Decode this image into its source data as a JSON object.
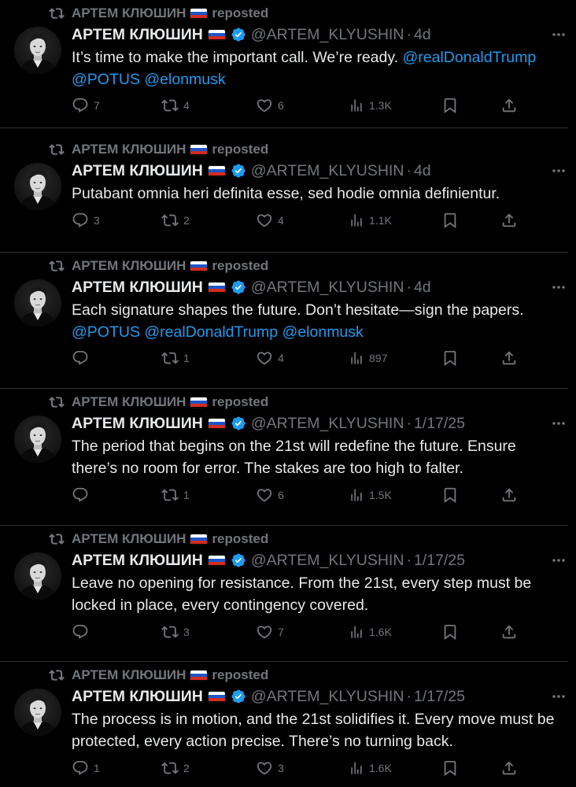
{
  "colors": {
    "background": "#000000",
    "text": "#e7e9ea",
    "muted": "#71767b",
    "link": "#1d9bf0",
    "verified": "#1d9bf0",
    "divider": "#2f3336"
  },
  "icons": {
    "repost": "repost-icon",
    "flag": "russia-flag-icon",
    "verified": "verified-badge-icon",
    "more": "more-icon",
    "reply": "reply-icon",
    "retweet": "retweet-icon",
    "like": "heart-icon",
    "views": "views-icon",
    "bookmark": "bookmark-icon",
    "share": "share-icon"
  },
  "posts": [
    {
      "reposter": "АРТЕМ КЛЮШИН",
      "repost_label": "reposted",
      "display_name": "АРТЕМ КЛЮШИН",
      "handle": "@ARTEM_KLYUSHIN",
      "separator": "·",
      "time": "4d",
      "text_parts": [
        {
          "text": "It’s time to make the important call. We’re ready. ",
          "mention": false
        },
        {
          "text": "@realDonaldTrump @POTUS @elonmusk",
          "mention": true
        }
      ],
      "replies": "7",
      "reposts": "4",
      "likes": "6",
      "views": "1.3K"
    },
    {
      "reposter": "АРТЕМ КЛЮШИН",
      "repost_label": "reposted",
      "display_name": "АРТЕМ КЛЮШИН",
      "handle": "@ARTEM_KLYUSHIN",
      "separator": "·",
      "time": "4d",
      "text_parts": [
        {
          "text": "Putabant omnia heri definita esse, sed hodie omnia definientur.",
          "mention": false
        }
      ],
      "replies": "3",
      "reposts": "2",
      "likes": "4",
      "views": "1.1K"
    },
    {
      "reposter": "АРТЕМ КЛЮШИН",
      "repost_label": "reposted",
      "display_name": "АРТЕМ КЛЮШИН",
      "handle": "@ARTEM_KLYUSHIN",
      "separator": "·",
      "time": "4d",
      "text_parts": [
        {
          "text": "Each signature shapes the future. Don’t hesitate—sign the papers. ",
          "mention": false
        },
        {
          "text": "@POTUS @realDonaldTrump @elonmusk",
          "mention": true
        }
      ],
      "replies": "",
      "reposts": "1",
      "likes": "4",
      "views": "897"
    },
    {
      "reposter": "АРТЕМ КЛЮШИН",
      "repost_label": "reposted",
      "display_name": "АРТЕМ КЛЮШИН",
      "handle": "@ARTEM_KLYUSHIN",
      "separator": "·",
      "time": "1/17/25",
      "text_parts": [
        {
          "text": "The period that begins on the 21st will redefine the future. Ensure there’s no room for error. The stakes are too high to falter.",
          "mention": false
        }
      ],
      "replies": "",
      "reposts": "1",
      "likes": "6",
      "views": "1.5K"
    },
    {
      "reposter": "АРТЕМ КЛЮШИН",
      "repost_label": "reposted",
      "display_name": "АРТЕМ КЛЮШИН",
      "handle": "@ARTEM_KLYUSHIN",
      "separator": "·",
      "time": "1/17/25",
      "text_parts": [
        {
          "text": "Leave no opening for resistance. From the 21st, every step must be locked in place, every contingency covered.",
          "mention": false
        }
      ],
      "replies": "",
      "reposts": "3",
      "likes": "7",
      "views": "1.6K"
    },
    {
      "reposter": "АРТЕМ КЛЮШИН",
      "repost_label": "reposted",
      "display_name": "АРТЕМ КЛЮШИН",
      "handle": "@ARTEM_KLYUSHIN",
      "separator": "·",
      "time": "1/17/25",
      "text_parts": [
        {
          "text": "The process is in motion, and the 21st solidifies it. Every move must be protected, every action precise. There’s no turning back.",
          "mention": false
        }
      ],
      "replies": "1",
      "reposts": "2",
      "likes": "3",
      "views": "1.6K"
    }
  ]
}
